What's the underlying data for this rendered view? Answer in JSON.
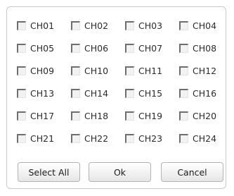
{
  "channels": [
    {
      "label": "CH01",
      "checked": false
    },
    {
      "label": "CH02",
      "checked": false
    },
    {
      "label": "CH03",
      "checked": false
    },
    {
      "label": "CH04",
      "checked": false
    },
    {
      "label": "CH05",
      "checked": false
    },
    {
      "label": "CH06",
      "checked": false
    },
    {
      "label": "CH07",
      "checked": false
    },
    {
      "label": "CH08",
      "checked": false
    },
    {
      "label": "CH09",
      "checked": false
    },
    {
      "label": "CH10",
      "checked": false
    },
    {
      "label": "CH11",
      "checked": false
    },
    {
      "label": "CH12",
      "checked": false
    },
    {
      "label": "CH13",
      "checked": false
    },
    {
      "label": "CH14",
      "checked": false
    },
    {
      "label": "CH15",
      "checked": false
    },
    {
      "label": "CH16",
      "checked": false
    },
    {
      "label": "CH17",
      "checked": false
    },
    {
      "label": "CH18",
      "checked": false
    },
    {
      "label": "CH19",
      "checked": false
    },
    {
      "label": "CH20",
      "checked": false
    },
    {
      "label": "CH21",
      "checked": false
    },
    {
      "label": "CH22",
      "checked": false
    },
    {
      "label": "CH23",
      "checked": false
    },
    {
      "label": "CH24",
      "checked": false
    }
  ],
  "buttons": {
    "select_all": "Select All",
    "ok": "Ok",
    "cancel": "Cancel"
  }
}
